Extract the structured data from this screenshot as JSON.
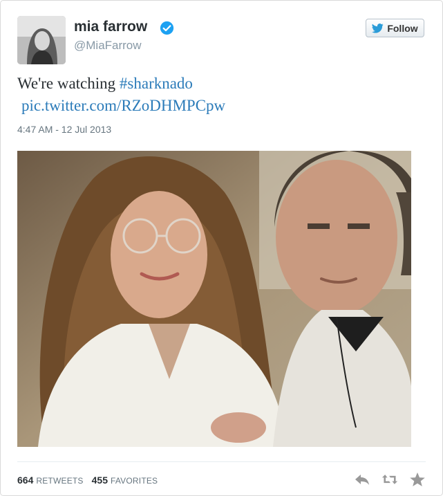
{
  "author": {
    "name": "mia farrow",
    "handle": "@MiaFarrow",
    "verified": true,
    "avatar_icon": "profile-photo"
  },
  "follow_button": {
    "label": "Follow",
    "icon": "twitter-bird-icon"
  },
  "tweet": {
    "text": "We're watching ",
    "hashtag": "#sharknado",
    "link": "pic.twitter.com/RZoDHMPCpw",
    "timestamp": "4:47 AM - 12 Jul 2013"
  },
  "media": {
    "type": "photo",
    "icon": "tweet-photo"
  },
  "stats": {
    "retweets_count": "664",
    "retweets_label": "RETWEETS",
    "favorites_count": "455",
    "favorites_label": "FAVORITES"
  },
  "actions": [
    {
      "name": "reply",
      "icon": "reply-icon"
    },
    {
      "name": "retweet",
      "icon": "retweet-icon"
    },
    {
      "name": "favorite",
      "icon": "star-icon"
    }
  ],
  "colors": {
    "link": "#2b7bb9",
    "verified": "#1da1f2",
    "muted": "#8899a6",
    "text": "#292f33",
    "action": "#999999"
  }
}
